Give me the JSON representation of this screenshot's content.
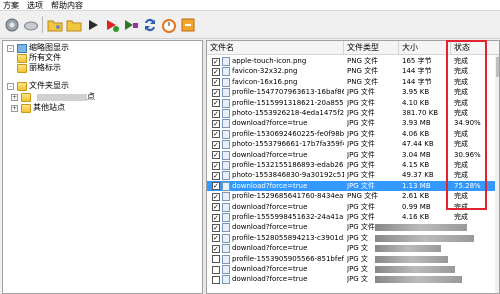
{
  "menu": [
    "方案",
    "选项",
    "帮助内容"
  ],
  "toolbar": {
    "icons": [
      "gear-icon",
      "cloud-icon",
      "folder-config-icon",
      "folder-open-icon",
      "play-icon",
      "play-record-icon",
      "stop-icon",
      "refresh-icon",
      "timer-icon",
      "exit-icon"
    ]
  },
  "tree": {
    "items": [
      {
        "label": "缩略图显示"
      },
      {
        "label": "所有文件"
      },
      {
        "label": "丽格标示"
      },
      {
        "label": "文件夹显示"
      },
      {
        "label": "点"
      },
      {
        "label": "其他站点"
      }
    ]
  },
  "table": {
    "columns": [
      "文件名",
      "文件类型",
      "大小",
      "状态"
    ],
    "rows": [
      {
        "name": "apple-touch-icon.png",
        "type": "PNG 文件",
        "size": "165 字节",
        "status": "完成",
        "checked": true
      },
      {
        "name": "favicon-32x32.png",
        "type": "PNG 文件",
        "size": "144 字节",
        "status": "完成",
        "checked": true
      },
      {
        "name": "favicon-16x16.png",
        "type": "PNG 文件",
        "size": "144 字节",
        "status": "完成",
        "checked": true
      },
      {
        "name": "profile-1547707963613-16baf868f...",
        "type": "JPG 文件",
        "size": "3.95 KB",
        "status": "完成",
        "checked": true
      },
      {
        "name": "profile-1515991318621-20a855788...",
        "type": "JPG 文件",
        "size": "4.10 KB",
        "status": "完成",
        "checked": true
      },
      {
        "name": "photo-1553926218-4eda1475f2c0?...",
        "type": "JPG 文件",
        "size": "381.70 KB",
        "status": "完成",
        "checked": true
      },
      {
        "name": "download?force=true",
        "type": "JPG 文件",
        "size": "3.93 MB",
        "status": "34.90%",
        "checked": true
      },
      {
        "name": "profile-1530692460225-fe0f98b6...",
        "type": "JPG 文件",
        "size": "4.06 KB",
        "status": "完成",
        "checked": true
      },
      {
        "name": "photo-1553796661-17b7fa359f4?...",
        "type": "JPG 文件",
        "size": "47.44 KB",
        "status": "完成",
        "checked": true
      },
      {
        "name": "download?force=true",
        "type": "JPG 文件",
        "size": "3.04 MB",
        "status": "30.96%",
        "checked": true
      },
      {
        "name": "profile-1532155186893-edab26741...",
        "type": "JPG 文件",
        "size": "4.15 KB",
        "status": "完成",
        "checked": true
      },
      {
        "name": "photo-1553846830-9a30192c5191?...",
        "type": "JPG 文件",
        "size": "49.37 KB",
        "status": "完成",
        "checked": true
      },
      {
        "name": "download?force=true",
        "type": "JPG 文件",
        "size": "1.13 MB",
        "status": "75.28%",
        "checked": true,
        "selected": true
      },
      {
        "name": "profile-1529685641760-8434eaff5...",
        "type": "PNG 文件",
        "size": "2.61 KB",
        "status": "完成",
        "checked": true
      },
      {
        "name": "download?force=true",
        "type": "JPG 文件",
        "size": "0.99 MB",
        "status": "完成",
        "checked": true
      },
      {
        "name": "profile-1555998451632-24a41a879...",
        "type": "JPG 文件",
        "size": "4.16 KB",
        "status": "完成",
        "checked": true
      },
      {
        "name": "download?force=true",
        "type": "JPG 文件",
        "size": "",
        "status": "",
        "checked": true
      },
      {
        "name": "profile-1528055894213-c3901d3e5...",
        "type": "JPG 文",
        "size": "",
        "status": "",
        "checked": true
      },
      {
        "name": "download?force=true",
        "type": "JPG 文",
        "size": "",
        "status": "",
        "checked": true
      },
      {
        "name": "profile-1553905905566-851bfefdd...",
        "type": "JPG 文",
        "size": "",
        "status": "",
        "checked": false
      },
      {
        "name": "download?force=true",
        "type": "JPG 文",
        "size": "",
        "status": "",
        "checked": false
      },
      {
        "name": "download?force=true",
        "type": "JPG 文",
        "size": "",
        "status": "",
        "checked": false
      }
    ]
  }
}
